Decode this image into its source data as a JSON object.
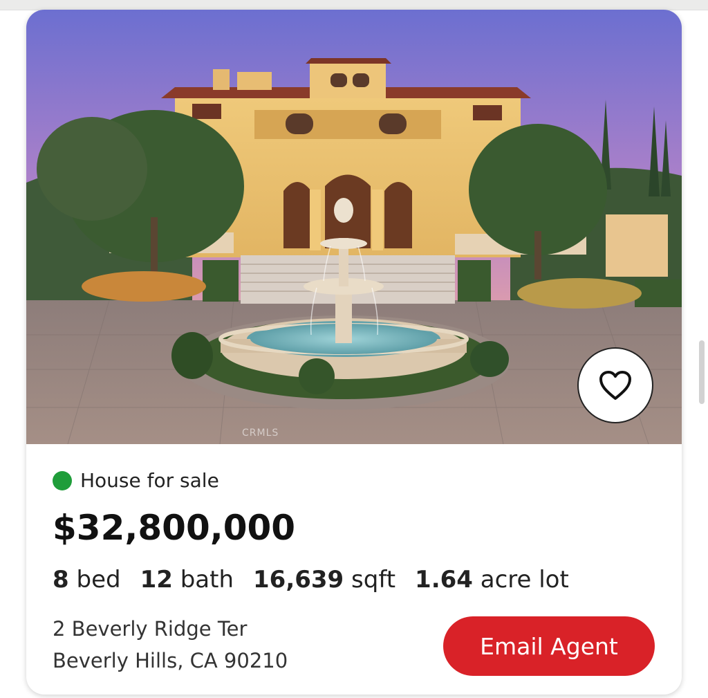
{
  "listing": {
    "status_label": "House for sale",
    "status_color": "#1f9d3a",
    "price": "$32,800,000",
    "specs": [
      {
        "value": "8",
        "unit": "bed"
      },
      {
        "value": "12",
        "unit": "bath"
      },
      {
        "value": "16,639",
        "unit": "sqft"
      },
      {
        "value": "1.64",
        "unit": "acre lot"
      }
    ],
    "address_line1": "2 Beverly Ridge Ter",
    "address_line2": "Beverly Hills, CA 90210",
    "photo_watermark": "CRMLS"
  },
  "actions": {
    "email_agent_label": "Email Agent",
    "email_agent_color": "#d92228",
    "favorite_icon": "heart-outline-icon"
  }
}
